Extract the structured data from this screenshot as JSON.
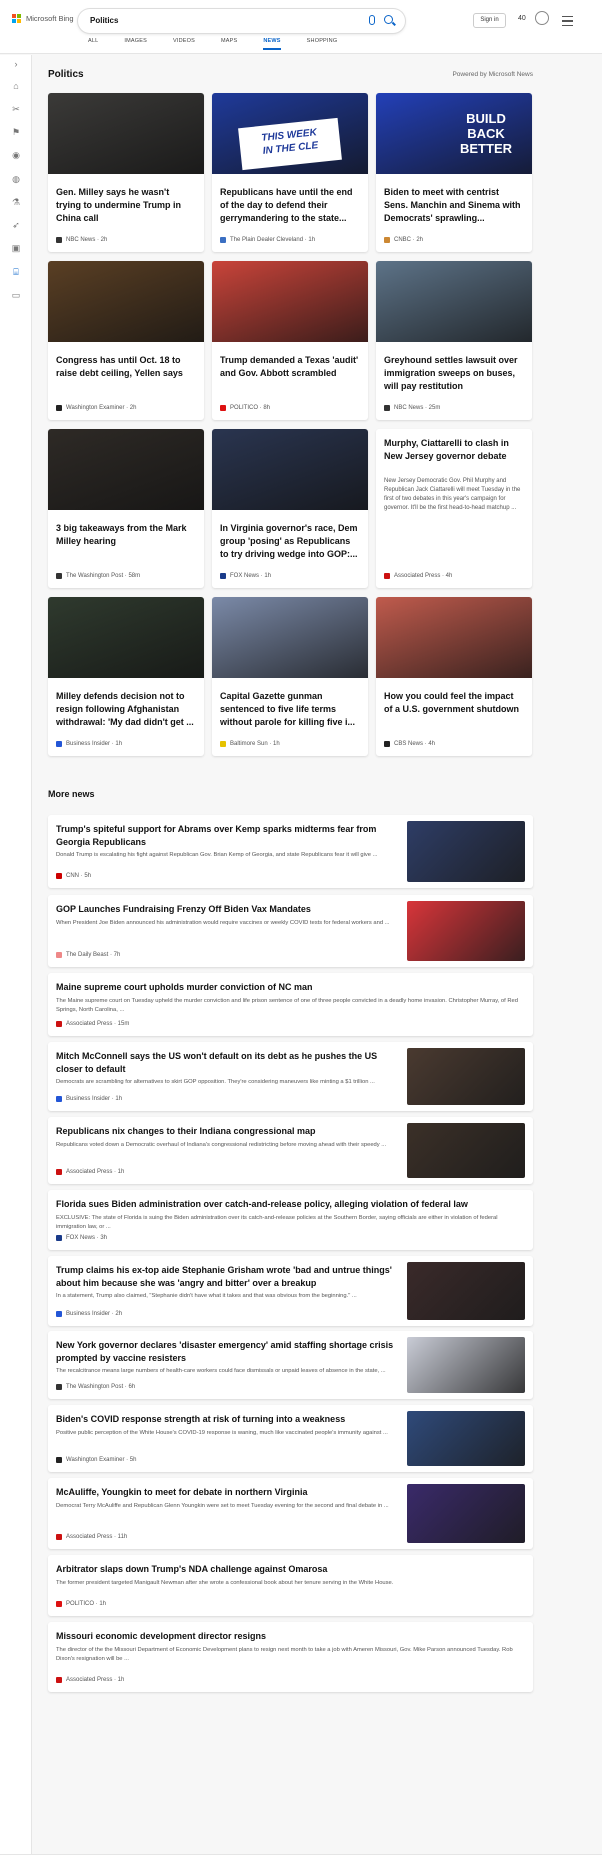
{
  "header": {
    "logo_text": "Microsoft Bing",
    "search_value": "Politics",
    "signin_label": "Sign in",
    "rewards_count": "40",
    "logo_colors": [
      "#f25022",
      "#7fba00",
      "#00a4ef",
      "#ffb900"
    ]
  },
  "tabs": [
    {
      "label": "ALL"
    },
    {
      "label": "IMAGES"
    },
    {
      "label": "VIDEOS"
    },
    {
      "label": "MAPS"
    },
    {
      "label": "NEWS",
      "active": true
    },
    {
      "label": "SHOPPING"
    }
  ],
  "rail_icons": [
    "expand-icon",
    "home-icon",
    "scissors-icon",
    "flag-icon",
    "location-icon",
    "globe-icon",
    "science-icon",
    "rocket-icon",
    "film-icon",
    "bank-icon",
    "card-icon"
  ],
  "section": {
    "title": "Politics",
    "powered_by": "Powered by Microsoft News"
  },
  "cards": [
    {
      "title": "Gen. Milley says he wasn't trying to undermine Trump in China call",
      "source": "NBC News · 2h",
      "img": "#3b3a38",
      "src_color": "#333"
    },
    {
      "title": "Republicans have until the end of the day to defend their gerrymandering to the state...",
      "source": "The Plain Dealer Cleveland · 1h",
      "img": "#1f3a9a",
      "src_color": "#3a6fc2",
      "banner_1": "THIS WEEK",
      "banner_2": "IN THE CLE"
    },
    {
      "title": "Biden to meet with centrist Sens. Manchin and Sinema with Democrats' sprawling...",
      "source": "CNBC · 2h",
      "img": "#2340b8",
      "src_color": "#c83",
      "banner": "BUILD BACK BETTER"
    },
    {
      "title": "Congress has until Oct. 18 to raise debt ceiling, Yellen says",
      "source": "Washington Examiner · 2h",
      "img": "#5a3f24",
      "src_color": "#222"
    },
    {
      "title": "Trump demanded a Texas 'audit' and Gov. Abbott scrambled",
      "source": "POLITICO · 8h",
      "img": "#c9443a",
      "src_color": "#d11"
    },
    {
      "title": "Greyhound settles lawsuit over immigration sweeps on buses, will pay restitution",
      "source": "NBC News · 25m",
      "img": "#5d7388",
      "src_color": "#333"
    },
    {
      "title": "3 big takeaways from the Mark Milley hearing",
      "source": "The Washington Post · 58m",
      "img": "#2e2a26",
      "src_color": "#333"
    },
    {
      "title": "In Virginia governor's race, Dem group 'posing' as Republicans to try driving wedge into GOP:...",
      "source": "FOX News · 1h",
      "img": "#2a3550",
      "src_color": "#1a3b8a"
    },
    {
      "title": "Murphy, Ciattarelli to clash in New Jersey governor debate",
      "snippet": "New Jersey Democratic Gov. Phil Murphy and Republican Jack Ciattarelli will meet Tuesday in the first of two debates in this year's campaign for governor. It'll be the first head-to-head matchup ...",
      "source": "Associated Press · 4h",
      "src_color": "#c11"
    },
    {
      "title": "Milley defends decision not to resign following Afghanistan withdrawal: 'My dad didn't get ...",
      "source": "Business Insider · 1h",
      "img": "#2f3a2e",
      "src_color": "#2356d6"
    },
    {
      "title": "Capital Gazette gunman sentenced to five life terms without parole for killing five i...",
      "source": "Baltimore Sun · 1h",
      "img": "#7b8aa8",
      "src_color": "#e6c200"
    },
    {
      "title": "How you could feel the impact of a U.S. government shutdown",
      "source": "CBS News · 4h",
      "img": "#c05b4d",
      "src_color": "#222"
    }
  ],
  "more": {
    "title": "More news",
    "items": [
      {
        "title": "Trump's spiteful support for Abrams over Kemp sparks midterms fear from Georgia Republicans",
        "snippet": "Donald Trump is escalating his fight against Republican Gov. Brian Kemp of Georgia, and state Republicans fear it will give ...",
        "source": "CNN · 5h",
        "src_color": "#c00",
        "img": "#2e3d66"
      },
      {
        "title": "GOP Launches Fundraising Frenzy Off Biden Vax Mandates",
        "snippet": "When President Joe Biden announced his administration would require vaccines or weekly COVID tests for federal workers and ...",
        "source": "The Daily Beast · 7h",
        "src_color": "#e88",
        "img": "#d8353a"
      },
      {
        "title": "Maine supreme court upholds murder conviction of NC man",
        "snippet": "The Maine supreme court on Tuesday upheld the murder conviction and life prison sentence of one of three people convicted in a deadly home invasion. Christopher Murray, of Red Springs, North Carolina, ...",
        "source": "Associated Press · 15m",
        "src_color": "#c11"
      },
      {
        "title": "Mitch McConnell says the US won't default on its debt as he pushes the US closer to default",
        "snippet": "Democrats are scrambling for alternatives to skirt GOP opposition. They're considering maneuvers like minting a $1 trillion ...",
        "source": "Business Insider · 1h",
        "src_color": "#2356d6",
        "img": "#4a3a30"
      },
      {
        "title": "Republicans nix changes to their Indiana congressional map",
        "snippet": "Republicans voted down a Democratic overhaul of Indiana's congressional redistricting before moving ahead with their speedy ...",
        "source": "Associated Press · 1h",
        "src_color": "#c11",
        "img": "#3b3028"
      },
      {
        "title": "Florida sues Biden administration over catch-and-release policy, alleging violation of federal law",
        "snippet": "EXCLUSIVE: The state of Florida is suing the Biden administration over its catch-and-release policies at the Southern Border, saying officials are either in violation of federal immigration law, or ...",
        "source": "FOX News · 3h",
        "src_color": "#1a3b8a"
      },
      {
        "title": "Trump claims his ex-top aide Stephanie Grisham wrote 'bad and untrue things' about him because she was 'angry and bitter' over a breakup",
        "snippet": "In a statement, Trump also claimed, \"Stephanie didn't have what it takes and that was obvious from the beginning.\" ...",
        "source": "Business Insider · 2h",
        "src_color": "#2356d6",
        "img": "#3a2a2a"
      },
      {
        "title": "New York governor declares 'disaster emergency' amid staffing shortage crisis prompted by vaccine resisters",
        "snippet": "The recalcitrance means large numbers of health-care workers could face dismissals or unpaid leaves of absence in the state, ...",
        "source": "The Washington Post · 6h",
        "src_color": "#333",
        "img": "#c9ccd6"
      },
      {
        "title": "Biden's COVID response strength at risk of turning into a weakness",
        "snippet": "Positive public perception of the White House's COVID-19 response is waning, much like vaccinated people's immunity against ...",
        "source": "Washington Examiner · 5h",
        "src_color": "#222",
        "img": "#2f4a7a"
      },
      {
        "title": "McAuliffe, Youngkin to meet for debate in northern Virginia",
        "snippet": "Democrat Terry McAuliffe and Republican Glenn Youngkin were set to meet Tuesday evening for the second and final debate in ...",
        "source": "Associated Press · 11h",
        "src_color": "#c11",
        "img": "#3a2a6a"
      },
      {
        "title": "Arbitrator slaps down Trump's NDA challenge against Omarosa",
        "snippet": "The former president targeted Manigault Newman after she wrote a confessional book about her tenure serving in the White House.",
        "source": "POLITICO · 1h",
        "src_color": "#d11"
      },
      {
        "title": "Missouri economic development director resigns",
        "snippet": "The director of the the Missouri Department of Economic Development plans to resign next month to take a job with Ameren Missouri, Gov. Mike Parson announced Tuesday. Rob Dixon's resignation will be ...",
        "source": "Associated Press · 1h",
        "src_color": "#c11"
      }
    ]
  }
}
